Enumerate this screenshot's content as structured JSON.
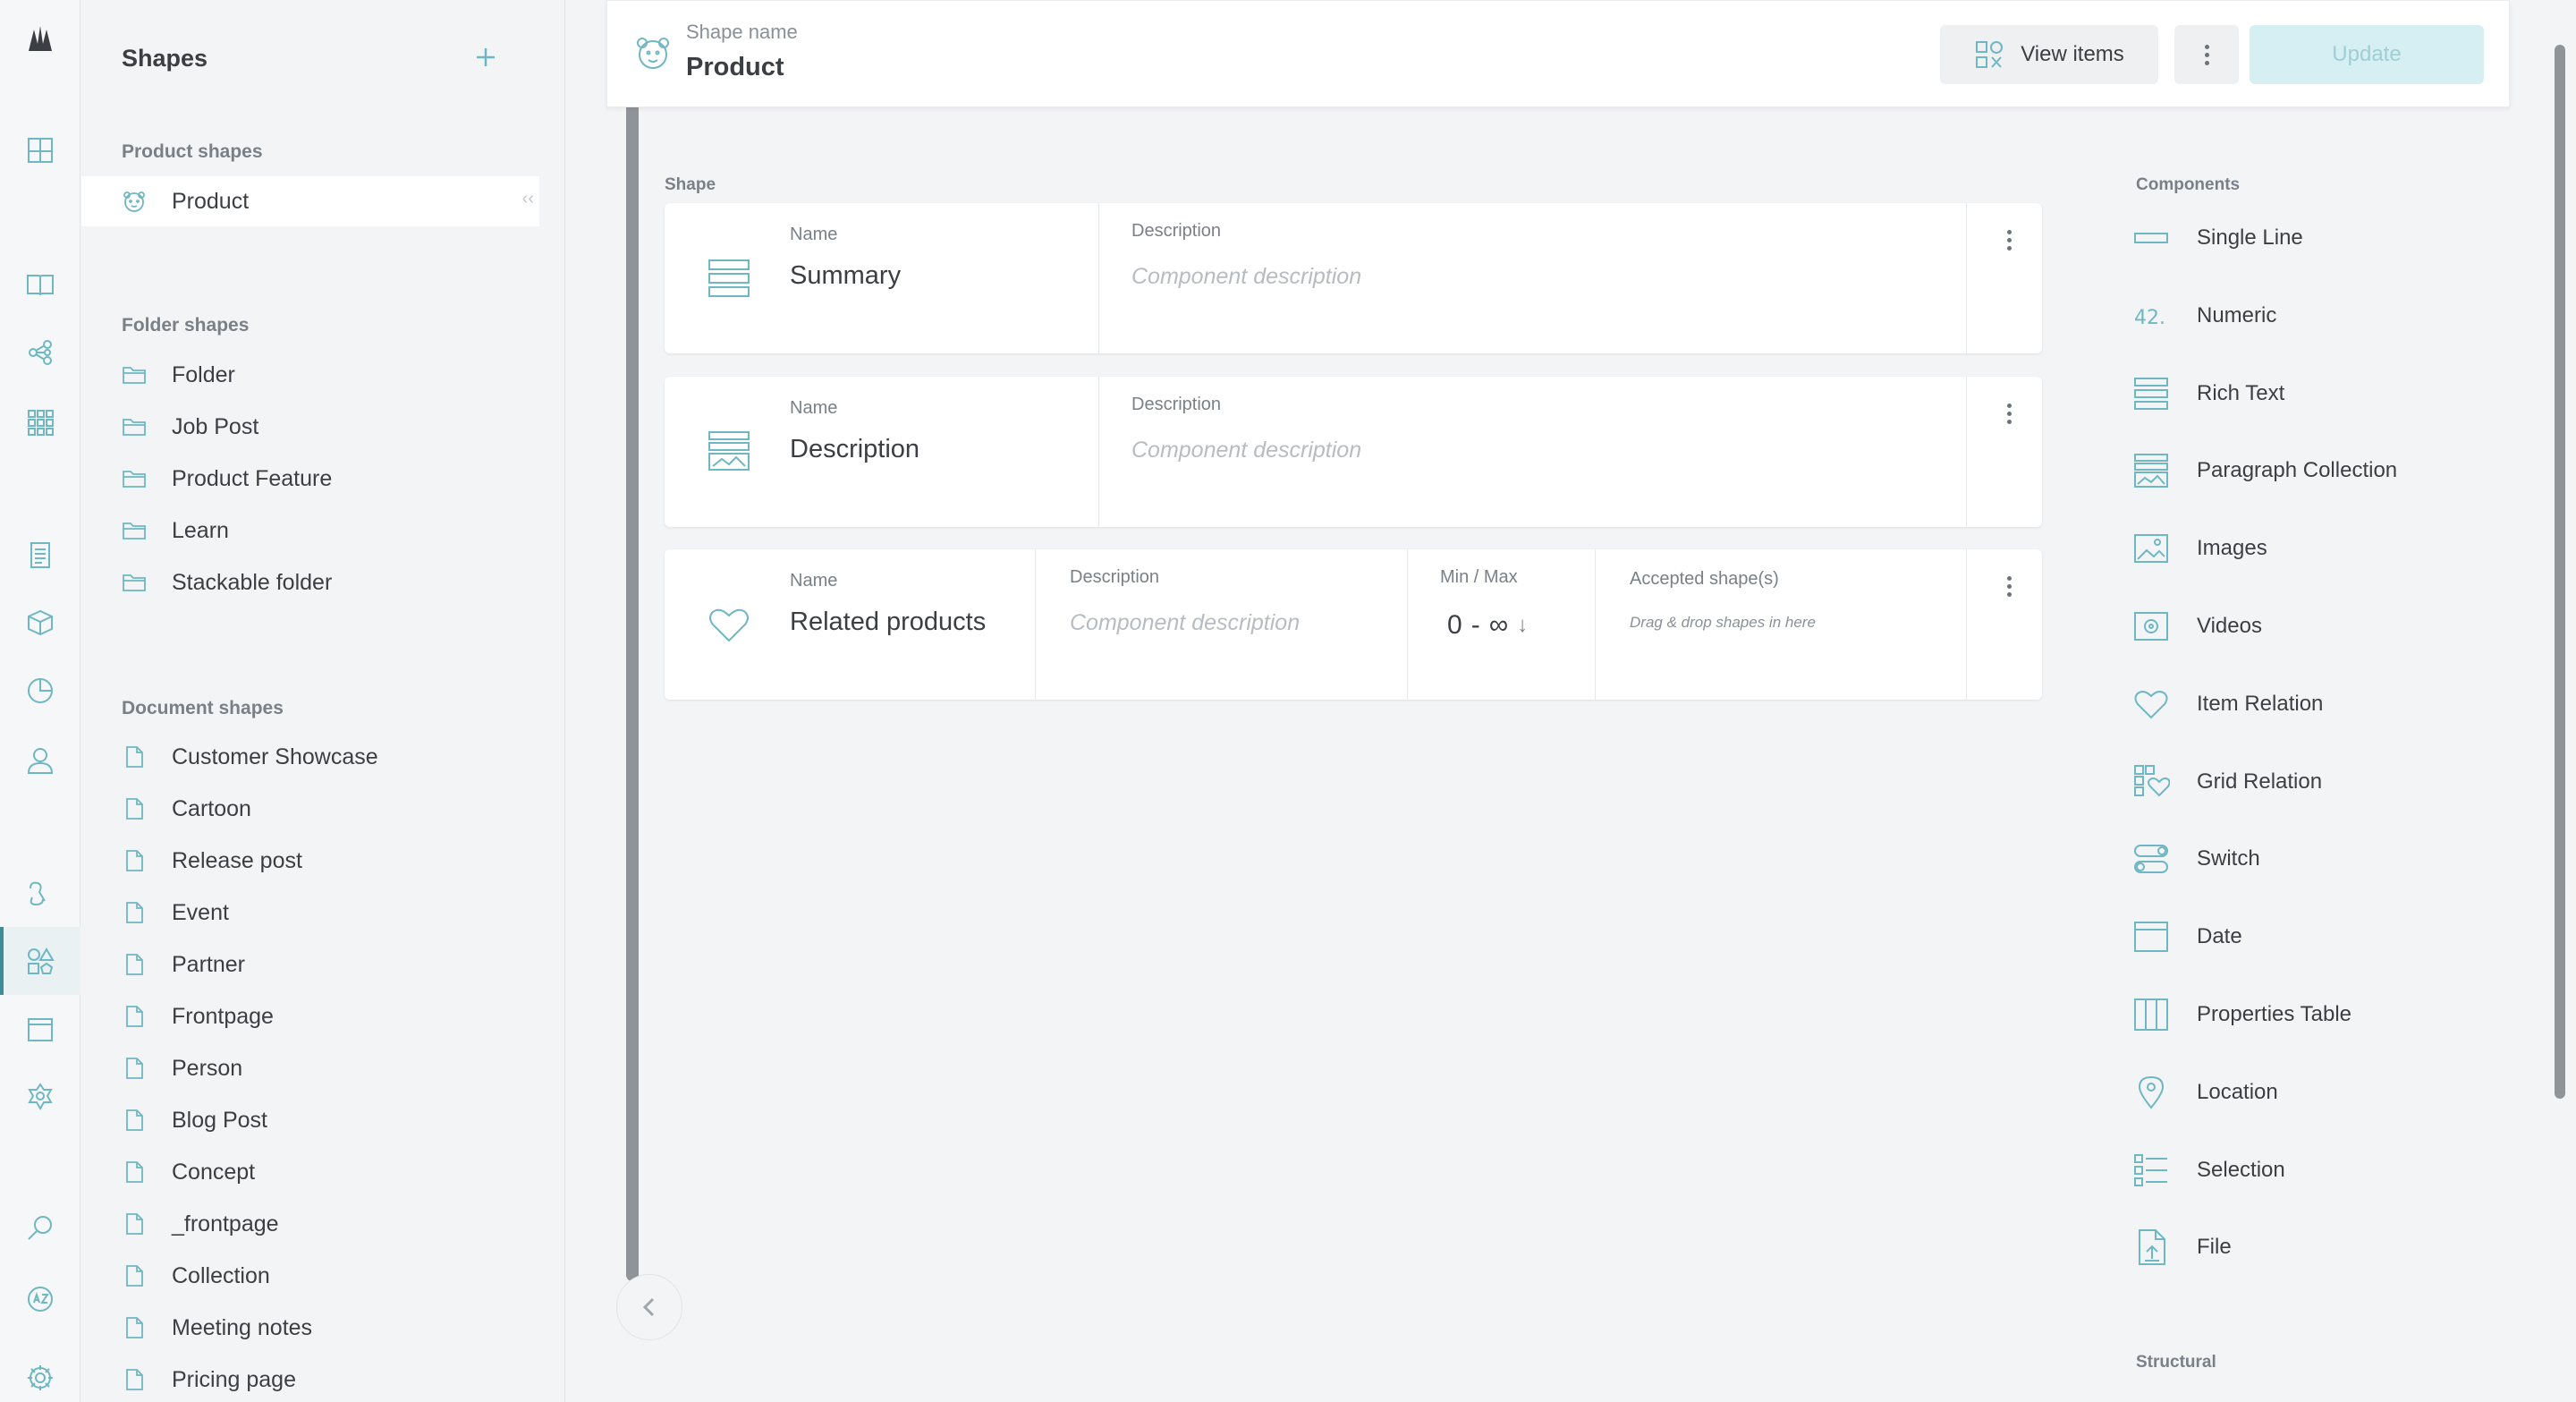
{
  "sidebar": {
    "title": "Shapes",
    "groups": [
      {
        "title": "Product shapes",
        "items": [
          {
            "label": "Product",
            "active": true
          }
        ]
      },
      {
        "title": "Folder shapes",
        "items": [
          {
            "label": "Folder"
          },
          {
            "label": "Job Post"
          },
          {
            "label": "Product Feature"
          },
          {
            "label": "Learn"
          },
          {
            "label": "Stackable folder"
          }
        ]
      },
      {
        "title": "Document shapes",
        "items": [
          {
            "label": "Customer Showcase"
          },
          {
            "label": "Cartoon"
          },
          {
            "label": "Release post"
          },
          {
            "label": "Event"
          },
          {
            "label": "Partner"
          },
          {
            "label": "Frontpage"
          },
          {
            "label": "Person"
          },
          {
            "label": "Blog Post"
          },
          {
            "label": "Concept"
          },
          {
            "label": "_frontpage"
          },
          {
            "label": "Collection"
          },
          {
            "label": "Meeting notes"
          },
          {
            "label": "Pricing page"
          }
        ]
      }
    ]
  },
  "header": {
    "shape_name_label": "Shape name",
    "shape_name": "Product",
    "view_items_label": "View items",
    "update_label": "Update"
  },
  "shape": {
    "section_title": "Shape",
    "rows": [
      {
        "icon": "rich-text-icon",
        "name_label": "Name",
        "name": "Summary",
        "desc_label": "Description",
        "desc_placeholder": "Component description"
      },
      {
        "icon": "paragraph-collection-icon",
        "name_label": "Name",
        "name": "Description",
        "desc_label": "Description",
        "desc_placeholder": "Component description"
      },
      {
        "icon": "item-relation-icon",
        "name_label": "Name",
        "name": "Related products",
        "desc_label": "Description",
        "desc_placeholder": "Component description",
        "minmax_label": "Min / Max",
        "min": "0",
        "max": "∞",
        "accepted_label": "Accepted shape(s)",
        "accepted_placeholder": "Drag & drop shapes in here"
      }
    ]
  },
  "components": {
    "section_title": "Components",
    "structural_title": "Structural",
    "items": [
      {
        "label": "Single Line",
        "icon": "single-line-icon"
      },
      {
        "label": "Numeric",
        "icon": "numeric-icon"
      },
      {
        "label": "Rich Text",
        "icon": "rich-text-icon"
      },
      {
        "label": "Paragraph Collection",
        "icon": "paragraph-collection-icon"
      },
      {
        "label": "Images",
        "icon": "images-icon"
      },
      {
        "label": "Videos",
        "icon": "videos-icon"
      },
      {
        "label": "Item Relation",
        "icon": "item-relation-icon"
      },
      {
        "label": "Grid Relation",
        "icon": "grid-relation-icon"
      },
      {
        "label": "Switch",
        "icon": "switch-icon"
      },
      {
        "label": "Date",
        "icon": "date-icon"
      },
      {
        "label": "Properties Table",
        "icon": "properties-table-icon"
      },
      {
        "label": "Location",
        "icon": "location-icon"
      },
      {
        "label": "Selection",
        "icon": "selection-icon"
      },
      {
        "label": "File",
        "icon": "file-icon"
      }
    ],
    "numeric_glyph": "42."
  },
  "rail": {
    "icons": [
      "logo-icon",
      "dashboard-icon",
      "catalogue-icon",
      "topics-icon",
      "grids-icon",
      "orders-icon",
      "products-icon",
      "stats-icon",
      "customers-icon",
      "webhooks-icon",
      "shapes-icon",
      "pages-icon",
      "price-icon",
      "search-icon",
      "translations-icon",
      "settings-icon"
    ]
  },
  "colors": {
    "accent": "#6fb7c2",
    "accent_dark": "#3f8c99",
    "update_bg": "#d6eff2"
  }
}
